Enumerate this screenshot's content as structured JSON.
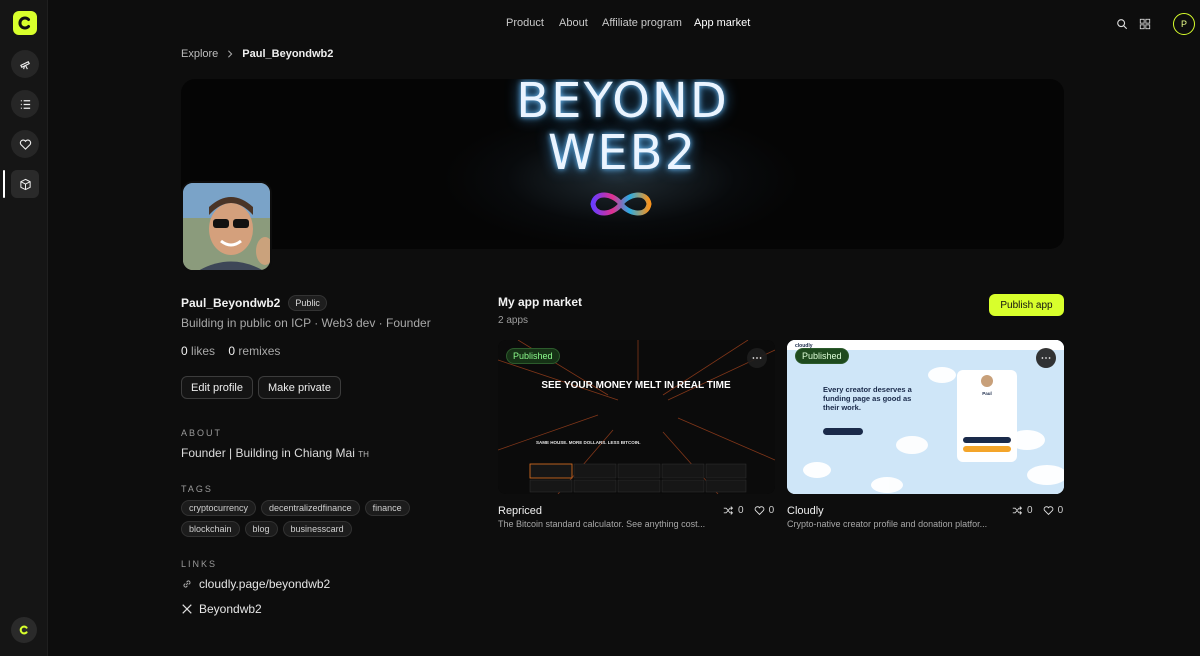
{
  "nav": {
    "items": [
      "Product",
      "About",
      "Affiliate program",
      "App market"
    ],
    "avatar_initial": "P"
  },
  "breadcrumb": {
    "root": "Explore",
    "current": "Paul_Beyondwb2"
  },
  "banner": {
    "line1": "BEYOND",
    "line2": "WEB2"
  },
  "profile": {
    "name": "Paul_Beyondwb2",
    "visibility": "Public",
    "bio": "Building in public on ICP · Web3 dev · Founder",
    "likes_count": "0",
    "likes_label": "likes",
    "remixes_count": "0",
    "remixes_label": "remixes",
    "edit_button": "Edit profile",
    "private_button": "Make private"
  },
  "about": {
    "heading": "ABOUT",
    "text": "Founder | Building in Chiang Mai",
    "flag": "TH"
  },
  "tags": {
    "heading": "TAGS",
    "items": [
      "cryptocurrency",
      "decentralizedfinance",
      "finance",
      "blockchain",
      "blog",
      "businesscard"
    ]
  },
  "links": {
    "heading": "LINKS",
    "website": "cloudly.page/beyondwb2",
    "x_handle": "Beyondwb2"
  },
  "market": {
    "title": "My app market",
    "count": "2 apps",
    "publish_button": "Publish app",
    "apps": [
      {
        "status": "Published",
        "name": "Repriced",
        "description": "The Bitcoin standard calculator. See anything cost...",
        "remixes": "0",
        "likes": "0",
        "preview_headline": "SEE YOUR MONEY MELT IN REAL TIME",
        "preview_sub": "SAME HOUSE. MORE DOLLARS. LESS BITCOIN."
      },
      {
        "status": "Published",
        "name": "Cloudly",
        "description": "Crypto-native creator profile and donation platfor...",
        "remixes": "0",
        "likes": "0",
        "preview_headline": "Every creator deserves a funding page as good as their work.",
        "preview_brand": "cloudly",
        "preview_user": "Paul"
      }
    ]
  },
  "colors": {
    "accent": "#d8ff2c",
    "background": "#0d0d0d"
  }
}
